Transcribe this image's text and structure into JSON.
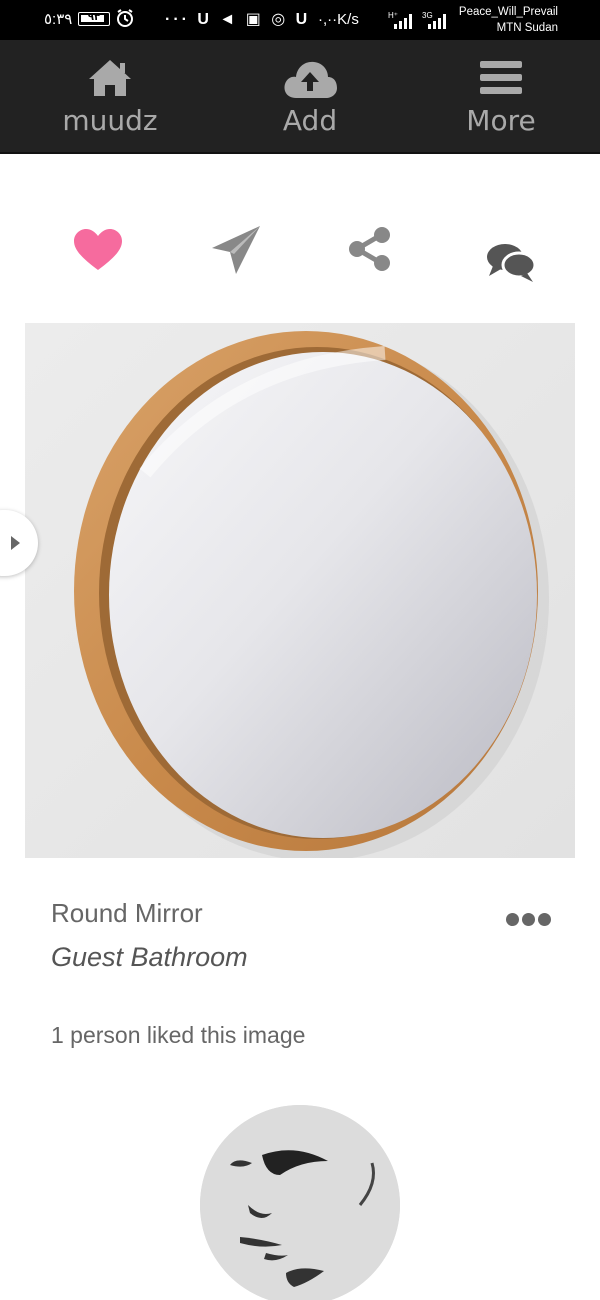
{
  "status_bar": {
    "time": "٥:٣٩",
    "battery": "٩٣",
    "battery_level": 0.93,
    "notifications": "··· U ◄ ▣ ◎ U",
    "speed": "·,··K/s",
    "signal_a": "H⁺",
    "signal_b": "3G",
    "carrier_line1": "Peace_Will_Prevail",
    "carrier_line2": "MTN Sudan"
  },
  "nav": {
    "home_label": "muudz",
    "add_label": "Add",
    "more_label": "More"
  },
  "actions": {
    "like_icon": "heart-icon",
    "send_icon": "paper-plane-icon",
    "share_icon": "share-icon",
    "comment_icon": "comments-icon"
  },
  "item": {
    "title": "Round Mirror",
    "room": "Guest Bathroom",
    "likes_text": "1 person liked this image"
  },
  "colors": {
    "nav_bg": "#222222",
    "nav_text": "#a9a9a9",
    "like": "#f66b9e",
    "icon_gray": "#888888",
    "text_gray": "#666666"
  }
}
